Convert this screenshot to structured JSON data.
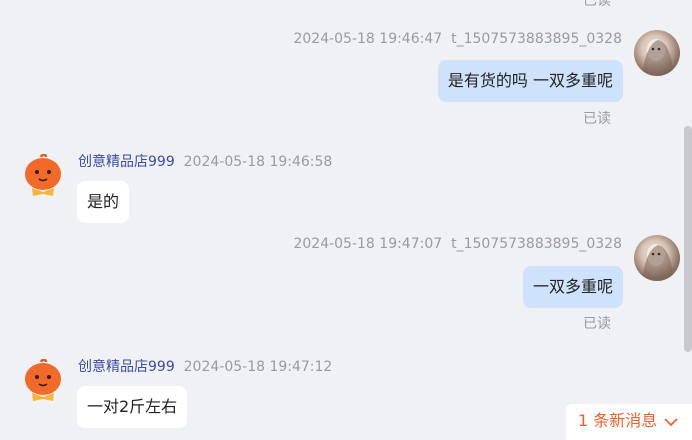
{
  "top_read": "已读",
  "messages": [
    {
      "direction": "out",
      "timestamp": "2024-05-18 19:46:47",
      "user": "t_1507573883895_0328",
      "text": "是有货的吗 一双多重呢",
      "status": "已读"
    },
    {
      "direction": "in",
      "shop": "创意精品店999",
      "timestamp": "2024-05-18 19:46:58",
      "text": "是的"
    },
    {
      "direction": "out",
      "timestamp": "2024-05-18 19:47:07",
      "user": "t_1507573883895_0328",
      "text": "一双多重呢",
      "status": "已读"
    },
    {
      "direction": "in",
      "shop": "创意精品店999",
      "timestamp": "2024-05-18 19:47:12",
      "text": "一对2斤左右"
    }
  ],
  "new_message_notice": "1 条新消息",
  "colors": {
    "background": "#f0f1f5",
    "outgoing_bubble": "#cfe2fb",
    "incoming_bubble": "#ffffff",
    "sender_name": "#3b4ba3",
    "notice_accent": "#f0602a"
  }
}
